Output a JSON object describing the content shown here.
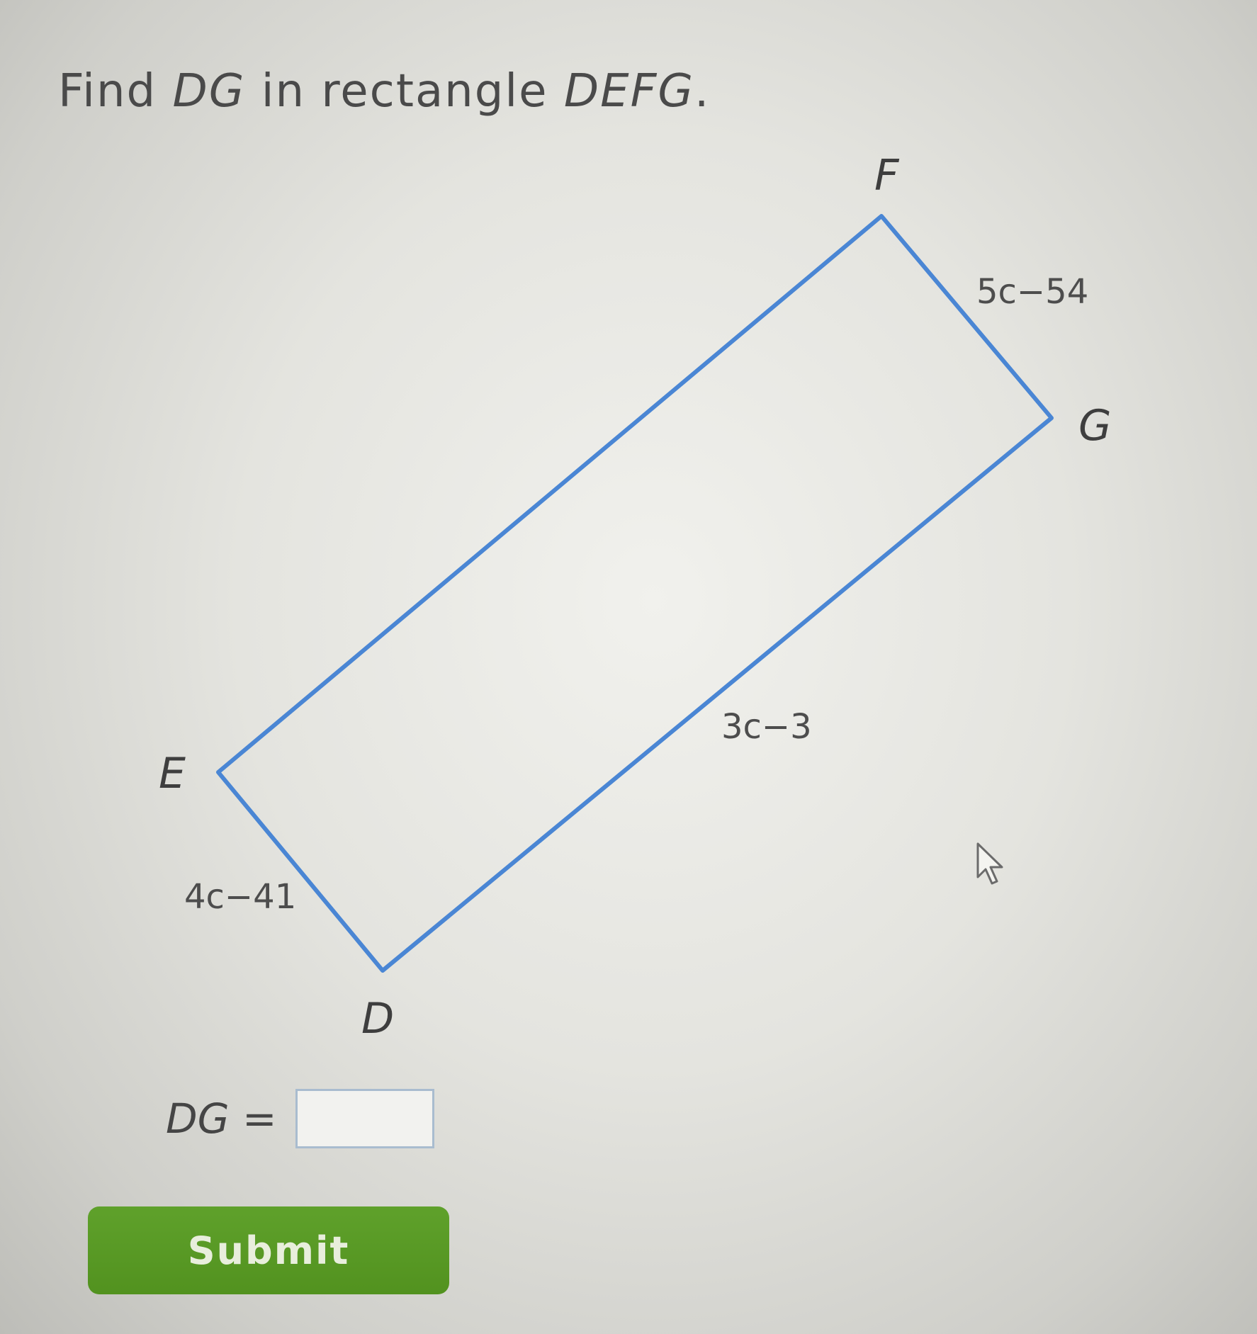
{
  "question": {
    "prefix": "Find ",
    "target": "DG",
    "middle": " in rectangle ",
    "shape": "DEFG",
    "suffix": "."
  },
  "figure": {
    "stroke_color": "#4a86d4",
    "vertices": {
      "F": "F",
      "G": "G",
      "E": "E",
      "D": "D"
    },
    "sides": {
      "FG": "5c−54",
      "DG": "3c−3",
      "ED": "4c−41"
    }
  },
  "answer": {
    "label": "DG =",
    "value": "",
    "placeholder": ""
  },
  "submit": {
    "label": "Submit",
    "color": "#57982a"
  },
  "cursor_icon": "arrow-cursor-icon"
}
